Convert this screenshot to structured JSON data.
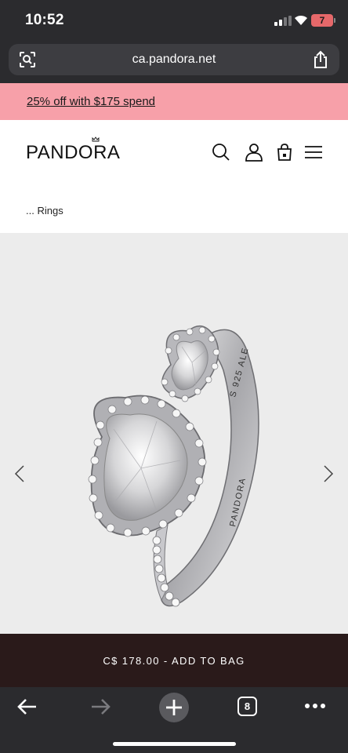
{
  "status": {
    "time": "10:52",
    "battery": "7"
  },
  "browser": {
    "url": "ca.pandora.net",
    "tab_count": "8"
  },
  "promo": {
    "text": "25% off with $175 spend"
  },
  "header": {
    "logo": "PANDORA"
  },
  "breadcrumb": {
    "ellipsis": "...",
    "current": "Rings"
  },
  "product": {
    "engraving_1": "S 925 ALE",
    "engraving_2": "PANDORA"
  },
  "cta": {
    "label": "C$ 178.00 - ADD TO BAG"
  }
}
